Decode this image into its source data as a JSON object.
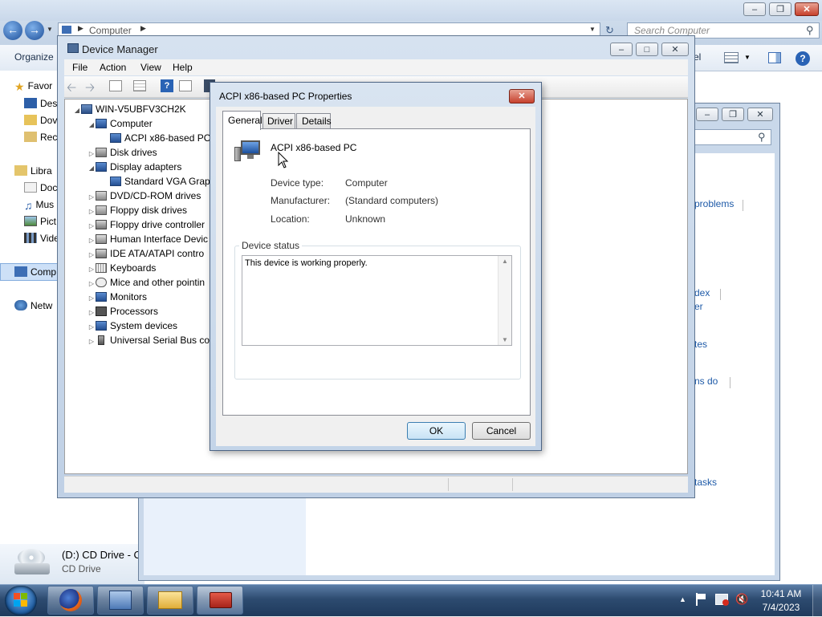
{
  "explorer": {
    "address_root": "Computer",
    "search_placeholder": "Search Computer",
    "organize_label": "Organize",
    "toolbar_partial": "el",
    "nav": {
      "favorites": "Favor",
      "desktop": "Des",
      "downloads": "Dov",
      "recent": "Rec",
      "libraries": "Libra",
      "documents": "Doc",
      "music": "Mus",
      "pictures": "Pict",
      "videos": "Vide",
      "computer": "Comp",
      "network": "Netw"
    },
    "status_drive_name": "(D:) CD Drive - C",
    "status_drive_type": "CD Drive"
  },
  "control_panel": {
    "links": [
      "problems",
      "dex",
      "er",
      "tes",
      "ns do",
      "tasks"
    ]
  },
  "device_manager": {
    "title": "Device Manager",
    "menu": [
      "File",
      "Action",
      "View",
      "Help"
    ],
    "tree": {
      "root": "WIN-V5UBFV3CH2K",
      "computer": "Computer",
      "acpi": "ACPI x86-based PC",
      "disk_drives": "Disk drives",
      "display_adapters": "Display adapters",
      "vga": "Standard VGA Grap",
      "dvd": "DVD/CD-ROM drives",
      "floppy_disk": "Floppy disk drives",
      "floppy_ctrl": "Floppy drive controller",
      "hid": "Human Interface Devic",
      "ide": "IDE ATA/ATAPI contro",
      "keyboards": "Keyboards",
      "mice": "Mice and other pointin",
      "monitors": "Monitors",
      "processors": "Processors",
      "system": "System devices",
      "usb": "Universal Serial Bus co"
    }
  },
  "properties_dialog": {
    "title": "ACPI x86-based PC Properties",
    "tabs": [
      "General",
      "Driver",
      "Details"
    ],
    "device_name": "ACPI x86-based PC",
    "device_type_label": "Device type:",
    "device_type_value": "Computer",
    "manufacturer_label": "Manufacturer:",
    "manufacturer_value": "(Standard computers)",
    "location_label": "Location:",
    "location_value": "Unknown",
    "status_group": "Device status",
    "status_text": "This device is working properly.",
    "ok": "OK",
    "cancel": "Cancel"
  },
  "taskbar": {
    "time": "10:41 AM",
    "date": "7/4/2023"
  },
  "colors": {
    "aero_glass": "#c9d8ea",
    "selection": "#cde0f7",
    "close_red": "#c7412d",
    "link_blue": "#1e5aa8",
    "taskbar": "#2d4b70"
  }
}
